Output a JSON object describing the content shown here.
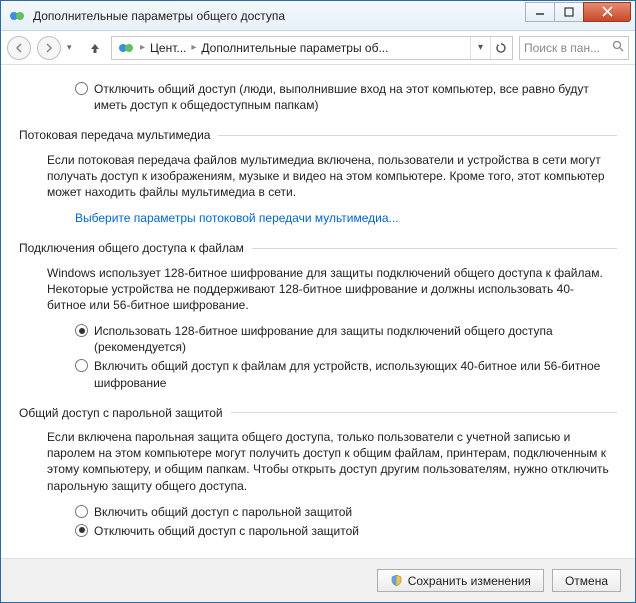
{
  "titlebar": {
    "title": "Дополнительные параметры общего доступа"
  },
  "nav": {
    "breadcrumb": {
      "seg1": "Цент...",
      "seg2": "Дополнительные параметры об..."
    },
    "search_placeholder": "Поиск в пан..."
  },
  "orphan_radio": {
    "label": "Отключить общий доступ (люди, выполнившие вход на этот компьютер, все равно будут иметь доступ к общедоступным папкам)"
  },
  "stream": {
    "header": "Потоковая передача мультимедиа",
    "desc": "Если потоковая передача файлов мультимедиа включена, пользователи и устройства в сети могут получать доступ к изображениям, музыке и видео на этом компьютере. Кроме того, этот компьютер может находить файлы мультимедиа в сети.",
    "link": "Выберите параметры потоковой передачи мультимедиа..."
  },
  "encryption": {
    "header": "Подключения общего доступа к файлам",
    "desc": "Windows использует 128-битное шифрование для защиты подключений общего доступа к файлам. Некоторые устройства не поддерживают 128-битное шифрование и должны использовать 40-битное или 56-битное шифрование.",
    "opt1": "Использовать 128-битное шифрование для защиты подключений общего доступа (рекомендуется)",
    "opt2": "Включить общий доступ к файлам для устройств, использующих 40-битное или 56-битное шифрование"
  },
  "password": {
    "header": "Общий доступ с парольной защитой",
    "desc": "Если включена парольная защита общего доступа, только пользователи с учетной записью и паролем на этом компьютере могут получить доступ к общим файлам, принтерам, подключенным к этому компьютеру, и общим папкам. Чтобы открыть доступ другим пользователям, нужно отключить парольную защиту общего доступа.",
    "opt1": "Включить общий доступ с парольной защитой",
    "opt2": "Отключить общий доступ с парольной защитой"
  },
  "footer": {
    "save": "Сохранить изменения",
    "cancel": "Отмена"
  }
}
